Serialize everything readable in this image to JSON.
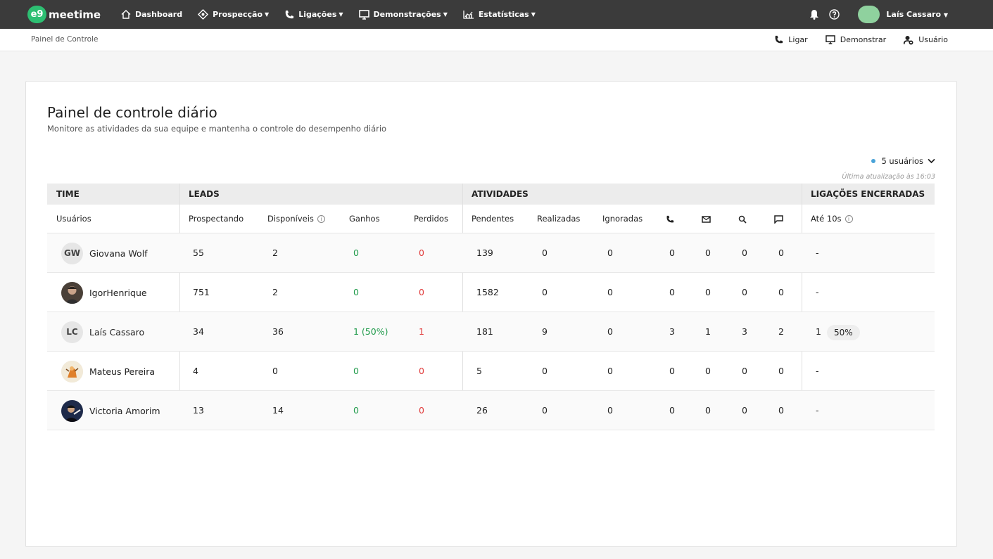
{
  "nav": {
    "logo_badge": "e9",
    "logo_text": "meetime",
    "items": [
      {
        "label": "Dashboard",
        "icon": "home-icon",
        "has_chevron": false
      },
      {
        "label": "Prospecção",
        "icon": "target-icon",
        "has_chevron": true
      },
      {
        "label": "Ligações",
        "icon": "phone-icon",
        "has_chevron": true
      },
      {
        "label": "Demonstrações",
        "icon": "monitor-icon",
        "has_chevron": true
      },
      {
        "label": "Estatísticas",
        "icon": "chart-icon",
        "has_chevron": true
      }
    ],
    "user_name": "Laís Cassaro"
  },
  "subheader": {
    "breadcrumb": "Painel de Controle",
    "actions": [
      {
        "label": "Ligar",
        "icon": "phone-icon"
      },
      {
        "label": "Demonstrar",
        "icon": "monitor-icon"
      },
      {
        "label": "Usuário",
        "icon": "user-add-icon"
      }
    ]
  },
  "panel": {
    "title": "Painel de controle diário",
    "subtitle": "Monitore as atividades da sua equipe e mantenha o controle do desempenho diário",
    "users_filter": "5 usuários",
    "last_update": "Última atualização às 16:03"
  },
  "table": {
    "groups": {
      "time": "TIME",
      "leads": "LEADS",
      "atividades": "ATIVIDADES",
      "ligacoes": "LIGAÇÕES ENCERRADAS"
    },
    "headers": {
      "usuarios": "Usuários",
      "prospectando": "Prospectando",
      "disponiveis": "Disponíveis",
      "ganhos": "Ganhos",
      "perdidos": "Perdidos",
      "pendentes": "Pendentes",
      "realizadas": "Realizadas",
      "ignoradas": "Ignoradas",
      "ate10s": "Até 10s"
    },
    "rows": [
      {
        "initials": "GW",
        "name": "Giovana Wolf",
        "prospectando": "55",
        "disponiveis": "2",
        "ganhos": "0",
        "perdidos": "0",
        "pendentes": "139",
        "realizadas": "0",
        "ignoradas": "0",
        "calls": "0",
        "emails": "0",
        "searches": "0",
        "messages": "0",
        "ate10s": "-",
        "ate10s_pct": ""
      },
      {
        "initials": "",
        "name": "IgorHenrique",
        "prospectando": "751",
        "disponiveis": "2",
        "ganhos": "0",
        "perdidos": "0",
        "pendentes": "1582",
        "realizadas": "0",
        "ignoradas": "0",
        "calls": "0",
        "emails": "0",
        "searches": "0",
        "messages": "0",
        "ate10s": "-",
        "ate10s_pct": ""
      },
      {
        "initials": "LC",
        "name": "Laís Cassaro",
        "prospectando": "34",
        "disponiveis": "36",
        "ganhos": "1 (50%)",
        "perdidos": "1",
        "pendentes": "181",
        "realizadas": "9",
        "ignoradas": "0",
        "calls": "3",
        "emails": "1",
        "searches": "3",
        "messages": "2",
        "ate10s": "1",
        "ate10s_pct": "50%"
      },
      {
        "initials": "",
        "name": "Mateus Pereira",
        "prospectando": "4",
        "disponiveis": "0",
        "ganhos": "0",
        "perdidos": "0",
        "pendentes": "5",
        "realizadas": "0",
        "ignoradas": "0",
        "calls": "0",
        "emails": "0",
        "searches": "0",
        "messages": "0",
        "ate10s": "-",
        "ate10s_pct": ""
      },
      {
        "initials": "",
        "name": "Victoria Amorim",
        "prospectando": "13",
        "disponiveis": "14",
        "ganhos": "0",
        "perdidos": "0",
        "pendentes": "26",
        "realizadas": "0",
        "ignoradas": "0",
        "calls": "0",
        "emails": "0",
        "searches": "0",
        "messages": "0",
        "ate10s": "-",
        "ate10s_pct": ""
      }
    ]
  }
}
